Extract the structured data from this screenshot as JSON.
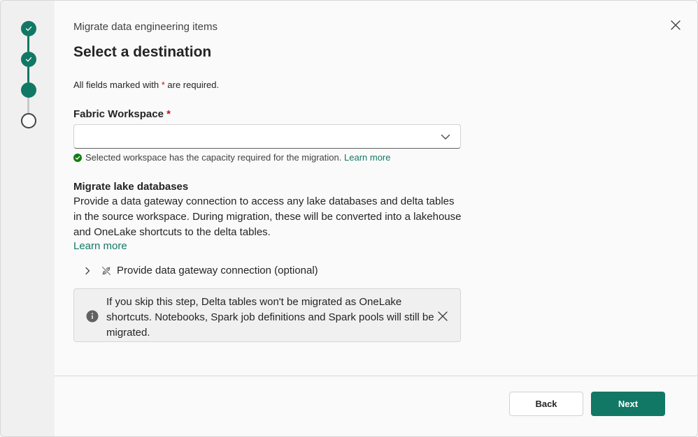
{
  "stepper": {
    "steps": [
      {
        "state": "done"
      },
      {
        "state": "done"
      },
      {
        "state": "current"
      },
      {
        "state": "todo"
      }
    ],
    "colors": {
      "active": "#117865",
      "inactive": "#c8c8c8"
    }
  },
  "header": {
    "subtitle": "Migrate data engineering items",
    "title": "Select a destination",
    "close_icon": "close-icon"
  },
  "form": {
    "required_note_prefix": "All fields marked with ",
    "required_star": "*",
    "required_note_suffix": " are required.",
    "workspace": {
      "label": "Fabric Workspace",
      "required_star": "*",
      "value": "",
      "validation_text": "Selected workspace has the capacity required for the migration.",
      "validation_link": "Learn more"
    }
  },
  "lake_section": {
    "title": "Migrate lake databases",
    "description": "Provide a data gateway connection to access any lake databases and delta tables in the source workspace. During migration, these will be converted into a lakehouse and OneLake shortcuts to the delta tables.",
    "learn_more": "Learn more",
    "expander_label": "Provide data gateway connection (optional)"
  },
  "infobar": {
    "text": "If you skip this step, Delta tables won't be migrated as OneLake shortcuts. Notebooks, Spark job definitions and Spark pools will still be migrated."
  },
  "footer": {
    "back_label": "Back",
    "next_label": "Next"
  },
  "colors": {
    "brand": "#117865",
    "required": "#c50f1f",
    "success": "#107c10"
  }
}
